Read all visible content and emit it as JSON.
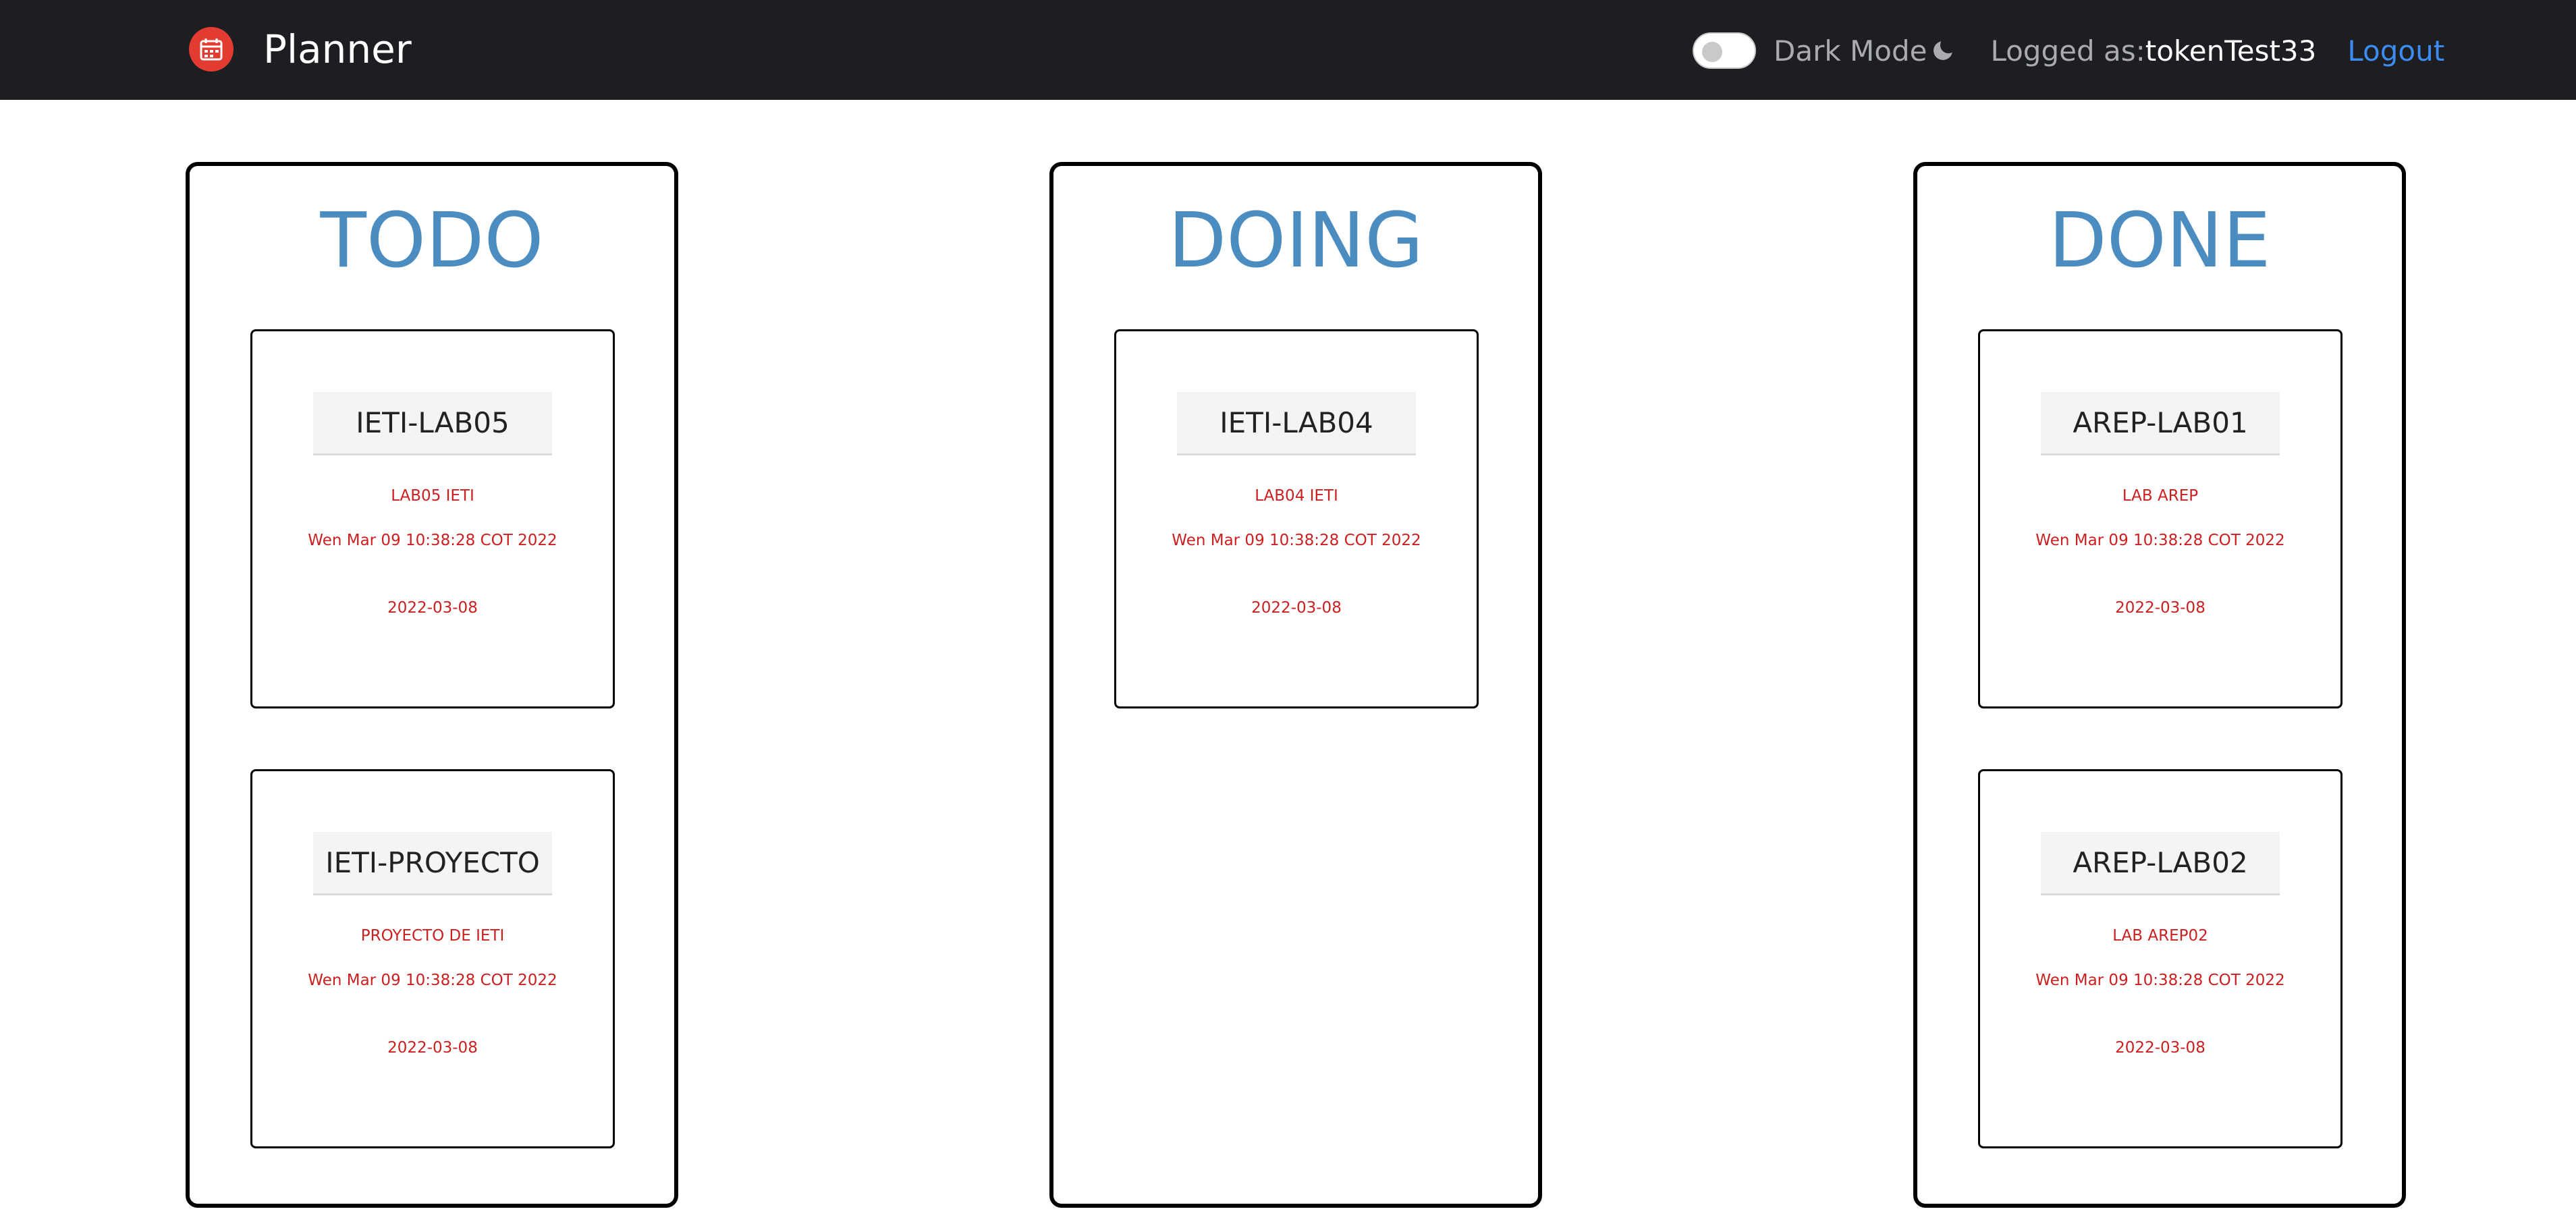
{
  "navbar": {
    "brand": "Planner",
    "dark_mode_label": "Dark Mode",
    "logged_label": "Logged as:",
    "username": "tokenTest33",
    "logout_label": "Logout",
    "dark_mode_enabled": false
  },
  "columns": [
    {
      "title": "TODO",
      "cards": [
        {
          "name": "IETI-LAB05",
          "description": "LAB05 IETI",
          "created": "Wen Mar 09 10:38:28 COT 2022",
          "due": "2022-03-08"
        },
        {
          "name": "IETI-PROYECTO",
          "description": "PROYECTO DE IETI",
          "created": "Wen Mar 09 10:38:28 COT 2022",
          "due": "2022-03-08"
        }
      ]
    },
    {
      "title": "DOING",
      "cards": [
        {
          "name": "IETI-LAB04",
          "description": "LAB04 IETI",
          "created": "Wen Mar 09 10:38:28 COT 2022",
          "due": "2022-03-08"
        }
      ]
    },
    {
      "title": "DONE",
      "cards": [
        {
          "name": "AREP-LAB01",
          "description": "LAB AREP",
          "created": "Wen Mar 09 10:38:28 COT 2022",
          "due": "2022-03-08"
        },
        {
          "name": "AREP-LAB02",
          "description": "LAB AREP02",
          "created": "Wen Mar 09 10:38:28 COT 2022",
          "due": "2022-03-08"
        }
      ]
    }
  ],
  "colors": {
    "navbar_bg": "#1c1e22",
    "column_title": "#4b8dc1",
    "card_text": "#cc2020",
    "logout_link": "#3d8cf2",
    "logo": "#e23b32"
  },
  "icons": {
    "logo": "planner-calendar-icon",
    "dark_mode": "moon-icon"
  }
}
